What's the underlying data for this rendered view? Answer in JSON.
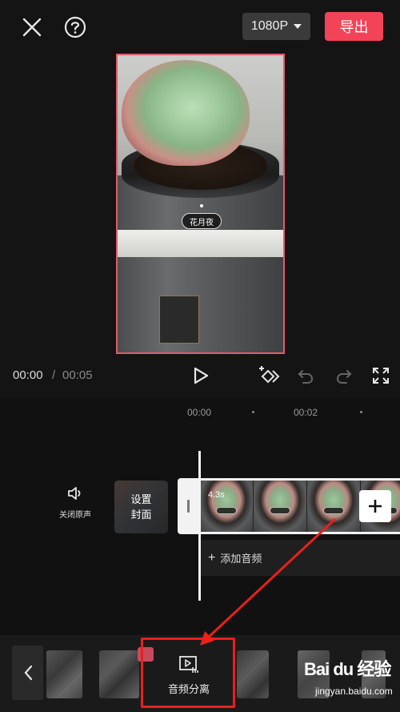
{
  "header": {
    "resolution": "1080P",
    "export_label": "导出"
  },
  "preview": {
    "overlay_tag": "花月夜"
  },
  "playback": {
    "current_time": "00:00",
    "separator": "/",
    "total_time": "00:05"
  },
  "timeline": {
    "ruler": [
      "00:00",
      "00:02"
    ],
    "mute_label": "关闭原声",
    "cover_line1": "设置",
    "cover_line2": "封面",
    "clip_duration": "4.3s",
    "add_audio_label": "添加音频"
  },
  "toolbar": {
    "audio_split_label": "音频分离"
  },
  "watermark": {
    "brand": "Bai du 经验",
    "url": "jingyan.baidu.com"
  },
  "colors": {
    "accent": "#f24359",
    "highlight": "#e8211c",
    "preview_border": "#e35a6c"
  },
  "icons": [
    "close-icon",
    "help-icon",
    "chevron-down-icon",
    "play-icon",
    "keyframe-icon",
    "undo-icon",
    "redo-icon",
    "fullscreen-icon",
    "speaker-icon",
    "plus-icon",
    "chevron-left-icon",
    "audio-split-icon"
  ]
}
